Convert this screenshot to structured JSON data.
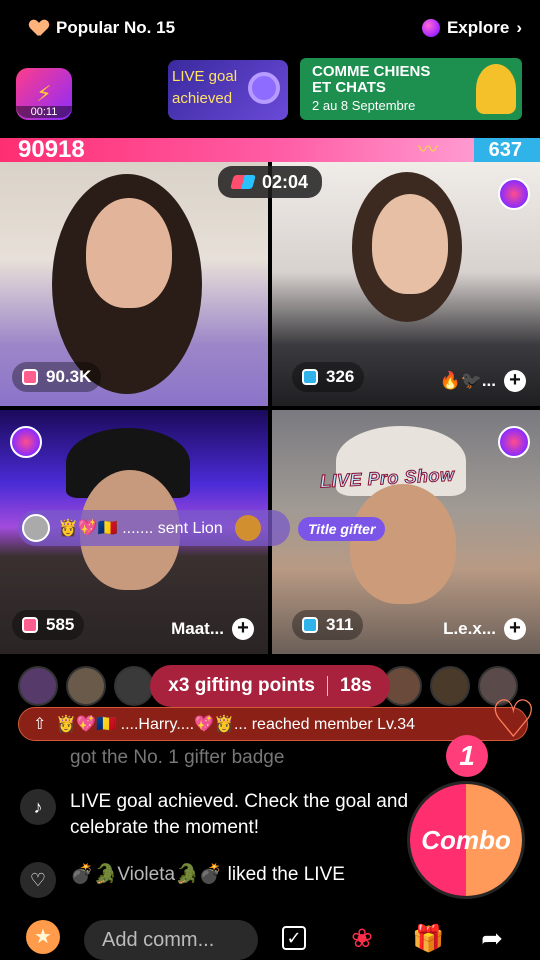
{
  "top": {
    "popular_label": "Popular No. 15",
    "explore_label": "Explore",
    "explore_chevron": "›"
  },
  "banners": {
    "timer": "00:11",
    "goal_text": "LIVE goal achieved",
    "ad_line1": "COMME CHIENS",
    "ad_line2": "ET CHATS",
    "ad_line3": "2 au 8 Septembre"
  },
  "battle": {
    "left_score": "90918",
    "right_score": "637",
    "left_fraction": 0.993,
    "countdown": "02:04"
  },
  "streams": [
    {
      "count": "90.3K",
      "name": "",
      "count_color": "#ff5e8e"
    },
    {
      "count": "326",
      "name": "🔥🐦‍⬛...",
      "count_color": "#2fb3e8"
    },
    {
      "count": "585",
      "name": "Maat...",
      "count_color": "#ff5e8e"
    },
    {
      "count": "311",
      "name": "L.e.x...",
      "count_color": "#2fb3e8"
    }
  ],
  "overlay": {
    "live_pro_show": "LIVE Pro Show",
    "sent_text": "👸💖🇷🇴 ....... sent Lion",
    "title_gifter": "Title gifter"
  },
  "gifting": {
    "label": "x3 gifting points",
    "timer": "18s"
  },
  "member": {
    "text": "👸💖🇷🇴 ....Harry....💖👸...  reached member Lv.34"
  },
  "chat": {
    "faded": "got the No. 1 gifter badge",
    "goal_message": "LIVE goal achieved. Check the goal and celebrate the moment!",
    "liker": "💣🐊Violeta🐊💣",
    "liked_text": "liked the LIVE"
  },
  "combo": {
    "count": "1",
    "label": "Combo"
  },
  "bottom": {
    "comment_placeholder": "Add comm..."
  }
}
